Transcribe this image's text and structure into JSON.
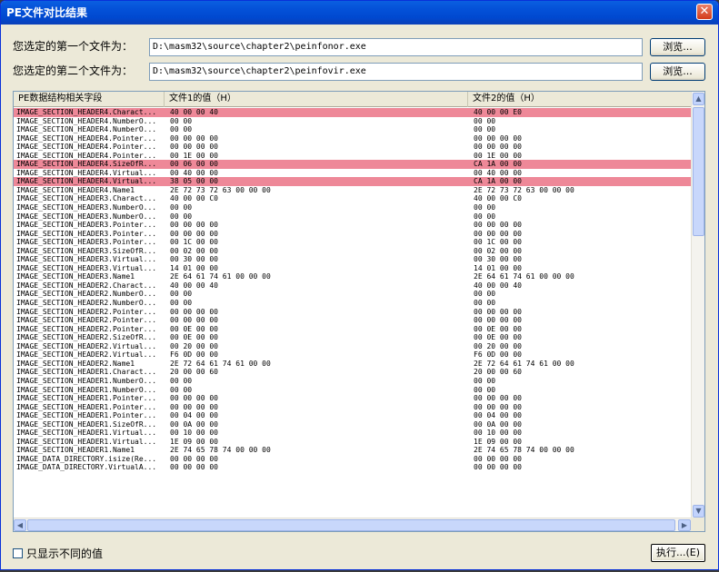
{
  "window": {
    "title": "PE文件对比结果"
  },
  "file1": {
    "label": "您选定的第一个文件为：",
    "path": "D:\\masm32\\source\\chapter2\\peinfonor.exe",
    "browse": "浏览..."
  },
  "file2": {
    "label": "您选定的第二个文件为：",
    "path": "D:\\masm32\\source\\chapter2\\peinfovir.exe",
    "browse": "浏览..."
  },
  "table": {
    "columns": [
      "PE数据结构相关字段",
      "文件1的值（H）",
      "文件2的值（H）"
    ],
    "rows": [
      {
        "f": "IMAGE_SECTION_HEADER4.Charact...",
        "v1": "40 00 00 40",
        "v2": "40 00 00 E0",
        "diff": true
      },
      {
        "f": "IMAGE_SECTION_HEADER4.NumberO...",
        "v1": "00 00",
        "v2": "00 00",
        "diff": false
      },
      {
        "f": "IMAGE_SECTION_HEADER4.NumberO...",
        "v1": "00 00",
        "v2": "00 00",
        "diff": false
      },
      {
        "f": "IMAGE_SECTION_HEADER4.Pointer...",
        "v1": "00 00 00 00",
        "v2": "00 00 00 00",
        "diff": false
      },
      {
        "f": "IMAGE_SECTION_HEADER4.Pointer...",
        "v1": "00 00 00 00",
        "v2": "00 00 00 00",
        "diff": false
      },
      {
        "f": "IMAGE_SECTION_HEADER4.Pointer...",
        "v1": "00 1E 00 00",
        "v2": "00 1E 00 00",
        "diff": false
      },
      {
        "f": "IMAGE_SECTION_HEADER4.SizeOfR...",
        "v1": "00 06 00 00",
        "v2": "CA 1A 00 00",
        "diff": true
      },
      {
        "f": "IMAGE_SECTION_HEADER4.Virtual...",
        "v1": "00 40 00 00",
        "v2": "00 40 00 00",
        "diff": false
      },
      {
        "f": "IMAGE_SECTION_HEADER4.Virtual...",
        "v1": "38 05 00 00",
        "v2": "CA 1A 00 00",
        "diff": true
      },
      {
        "f": "IMAGE_SECTION_HEADER4.Name1",
        "v1": "2E 72 73 72 63 00 00 00",
        "v2": "2E 72 73 72 63 00 00 00",
        "diff": false
      },
      {
        "f": "IMAGE_SECTION_HEADER3.Charact...",
        "v1": "40 00 00 C0",
        "v2": "40 00 00 C0",
        "diff": false
      },
      {
        "f": "IMAGE_SECTION_HEADER3.NumberO...",
        "v1": "00 00",
        "v2": "00 00",
        "diff": false
      },
      {
        "f": "IMAGE_SECTION_HEADER3.NumberO...",
        "v1": "00 00",
        "v2": "00 00",
        "diff": false
      },
      {
        "f": "IMAGE_SECTION_HEADER3.Pointer...",
        "v1": "00 00 00 00",
        "v2": "00 00 00 00",
        "diff": false
      },
      {
        "f": "IMAGE_SECTION_HEADER3.Pointer...",
        "v1": "00 00 00 00",
        "v2": "00 00 00 00",
        "diff": false
      },
      {
        "f": "IMAGE_SECTION_HEADER3.Pointer...",
        "v1": "00 1C 00 00",
        "v2": "00 1C 00 00",
        "diff": false
      },
      {
        "f": "IMAGE_SECTION_HEADER3.SizeOfR...",
        "v1": "00 02 00 00",
        "v2": "00 02 00 00",
        "diff": false
      },
      {
        "f": "IMAGE_SECTION_HEADER3.Virtual...",
        "v1": "00 30 00 00",
        "v2": "00 30 00 00",
        "diff": false
      },
      {
        "f": "IMAGE_SECTION_HEADER3.Virtual...",
        "v1": "14 01 00 00",
        "v2": "14 01 00 00",
        "diff": false
      },
      {
        "f": "IMAGE_SECTION_HEADER3.Name1",
        "v1": "2E 64 61 74 61 00 00 00",
        "v2": "2E 64 61 74 61 00 00 00",
        "diff": false
      },
      {
        "f": "IMAGE_SECTION_HEADER2.Charact...",
        "v1": "40 00 00 40",
        "v2": "40 00 00 40",
        "diff": false
      },
      {
        "f": "IMAGE_SECTION_HEADER2.NumberO...",
        "v1": "00 00",
        "v2": "00 00",
        "diff": false
      },
      {
        "f": "IMAGE_SECTION_HEADER2.NumberO...",
        "v1": "00 00",
        "v2": "00 00",
        "diff": false
      },
      {
        "f": "IMAGE_SECTION_HEADER2.Pointer...",
        "v1": "00 00 00 00",
        "v2": "00 00 00 00",
        "diff": false
      },
      {
        "f": "IMAGE_SECTION_HEADER2.Pointer...",
        "v1": "00 00 00 00",
        "v2": "00 00 00 00",
        "diff": false
      },
      {
        "f": "IMAGE_SECTION_HEADER2.Pointer...",
        "v1": "00 0E 00 00",
        "v2": "00 0E 00 00",
        "diff": false
      },
      {
        "f": "IMAGE_SECTION_HEADER2.SizeOfR...",
        "v1": "00 0E 00 00",
        "v2": "00 0E 00 00",
        "diff": false
      },
      {
        "f": "IMAGE_SECTION_HEADER2.Virtual...",
        "v1": "00 20 00 00",
        "v2": "00 20 00 00",
        "diff": false
      },
      {
        "f": "IMAGE_SECTION_HEADER2.Virtual...",
        "v1": "F6 0D 00 00",
        "v2": "F6 0D 00 00",
        "diff": false
      },
      {
        "f": "IMAGE_SECTION_HEADER2.Name1",
        "v1": "2E 72 64 61 74 61 00 00",
        "v2": "2E 72 64 61 74 61 00 00",
        "diff": false
      },
      {
        "f": "IMAGE_SECTION_HEADER1.Charact...",
        "v1": "20 00 00 60",
        "v2": "20 00 00 60",
        "diff": false
      },
      {
        "f": "IMAGE_SECTION_HEADER1.NumberO...",
        "v1": "00 00",
        "v2": "00 00",
        "diff": false
      },
      {
        "f": "IMAGE_SECTION_HEADER1.NumberO...",
        "v1": "00 00",
        "v2": "00 00",
        "diff": false
      },
      {
        "f": "IMAGE_SECTION_HEADER1.Pointer...",
        "v1": "00 00 00 00",
        "v2": "00 00 00 00",
        "diff": false
      },
      {
        "f": "IMAGE_SECTION_HEADER1.Pointer...",
        "v1": "00 00 00 00",
        "v2": "00 00 00 00",
        "diff": false
      },
      {
        "f": "IMAGE_SECTION_HEADER1.Pointer...",
        "v1": "00 04 00 00",
        "v2": "00 04 00 00",
        "diff": false
      },
      {
        "f": "IMAGE_SECTION_HEADER1.SizeOfR...",
        "v1": "00 0A 00 00",
        "v2": "00 0A 00 00",
        "diff": false
      },
      {
        "f": "IMAGE_SECTION_HEADER1.Virtual...",
        "v1": "00 10 00 00",
        "v2": "00 10 00 00",
        "diff": false
      },
      {
        "f": "IMAGE_SECTION_HEADER1.Virtual...",
        "v1": "1E 09 00 00",
        "v2": "1E 09 00 00",
        "diff": false
      },
      {
        "f": "IMAGE_SECTION_HEADER1.Name1",
        "v1": "2E 74 65 78 74 00 00 00",
        "v2": "2E 74 65 78 74 00 00 00",
        "diff": false
      },
      {
        "f": "IMAGE_DATA_DIRECTORY.isize(Re...",
        "v1": "00 00 00 00",
        "v2": "00 00 00 00",
        "diff": false
      },
      {
        "f": "IMAGE_DATA_DIRECTORY.VirtualA...",
        "v1": "00 00 00 00",
        "v2": "00 00 00 00",
        "diff": false
      }
    ]
  },
  "colors": {
    "diff_row": "#ee8898"
  },
  "footer": {
    "checkbox_label": "只显示不同的值",
    "execute_label": "执行...(E)"
  }
}
